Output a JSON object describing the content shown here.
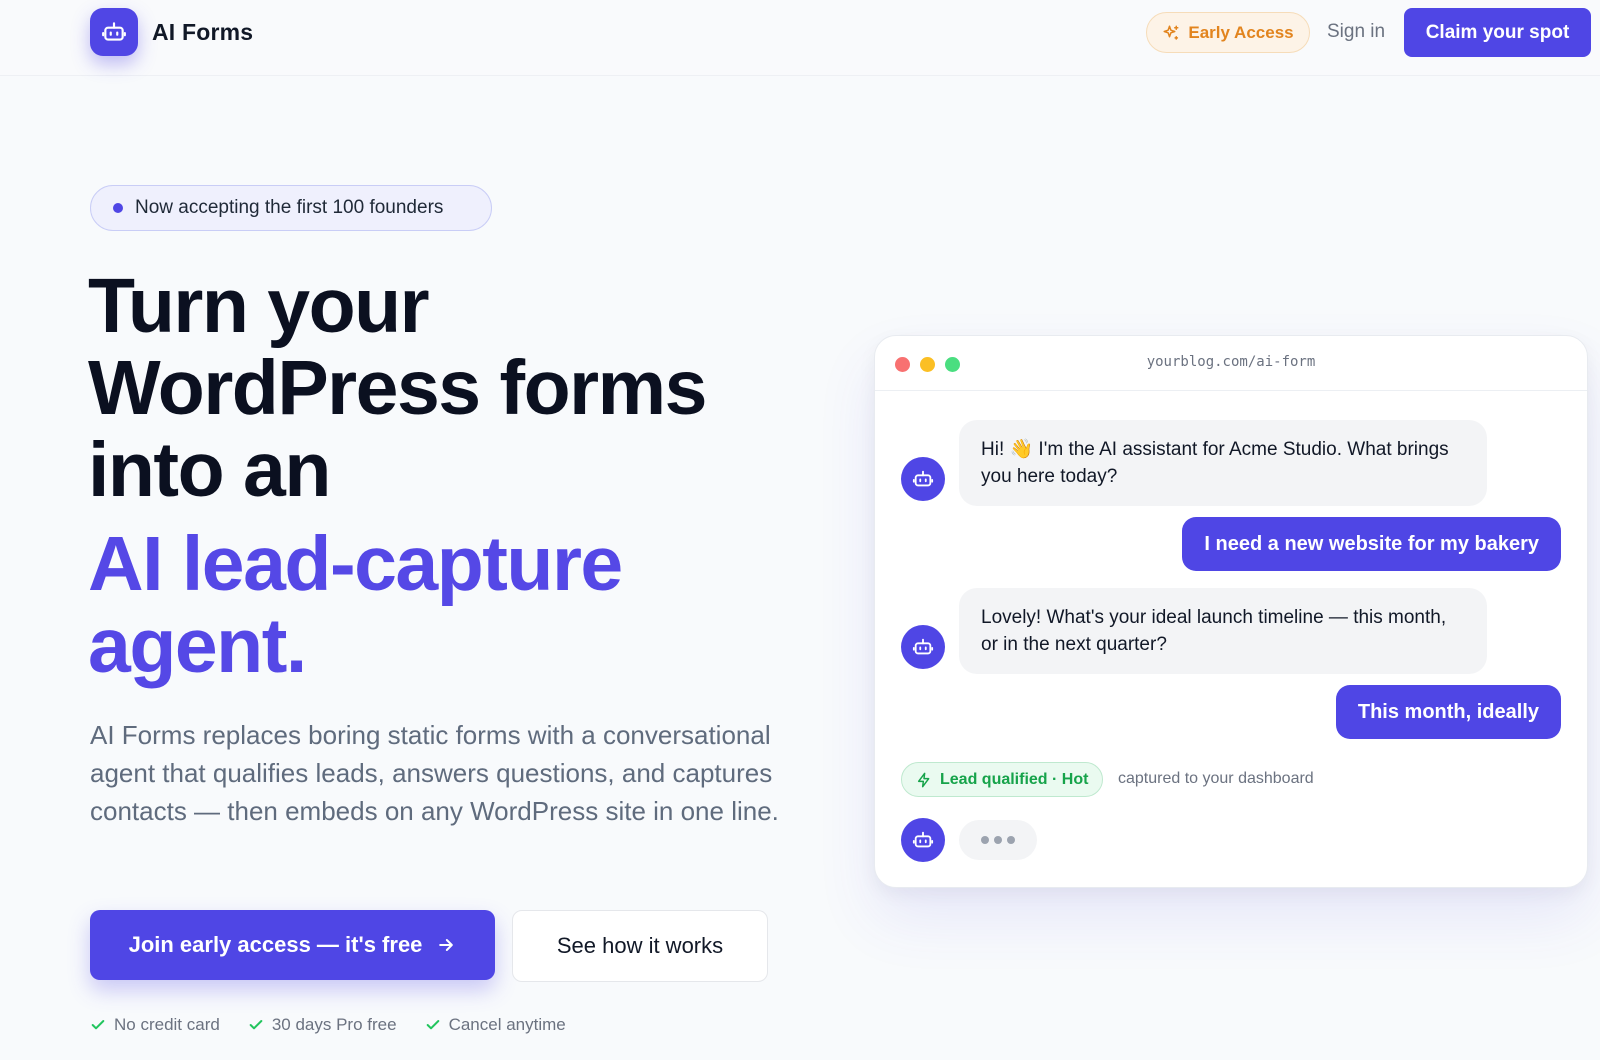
{
  "header": {
    "brand": "AI Forms",
    "early_access": "Early Access",
    "sign_in": "Sign in",
    "claim": "Claim your spot"
  },
  "hero": {
    "badge": "Now accepting the first 100 founders",
    "headline": {
      "line1": "Turn your",
      "line2": "WordPress forms",
      "line3": "into an",
      "accent1": "AI lead-capture",
      "accent2": "agent."
    },
    "subhead": "AI Forms replaces boring static forms with a conversational agent that qualifies leads, answers questions, and captures contacts — then embeds on any WordPress site in one line.",
    "cta_primary": "Join early access — it's free",
    "cta_secondary": "See how it works",
    "perks": [
      "No credit card",
      "30 days Pro free",
      "Cancel anytime"
    ]
  },
  "chat": {
    "url": "yourblog.com/ai-form",
    "messages": [
      {
        "role": "bot",
        "text": "Hi! 👋 I'm the AI assistant for Acme Studio. What brings you here today?"
      },
      {
        "role": "user",
        "text": "I need a new website for my bakery"
      },
      {
        "role": "bot",
        "text": "Lovely! What's your ideal launch timeline — this month, or in the next quarter?"
      },
      {
        "role": "user",
        "text": "This month, ideally"
      }
    ],
    "qualified_badge": "Lead qualified · Hot",
    "captured_note": "captured to your dashboard"
  },
  "colors": {
    "brand": "#4f46e5",
    "accent_text": "#5548e6",
    "early_access": "#e2841e",
    "success": "#16a34a"
  },
  "icons": {
    "logo": "robot-icon",
    "early_access": "sparkle-icon",
    "cta_arrow": "arrow-right-icon",
    "perk": "check-icon",
    "qualified": "bolt-icon"
  }
}
